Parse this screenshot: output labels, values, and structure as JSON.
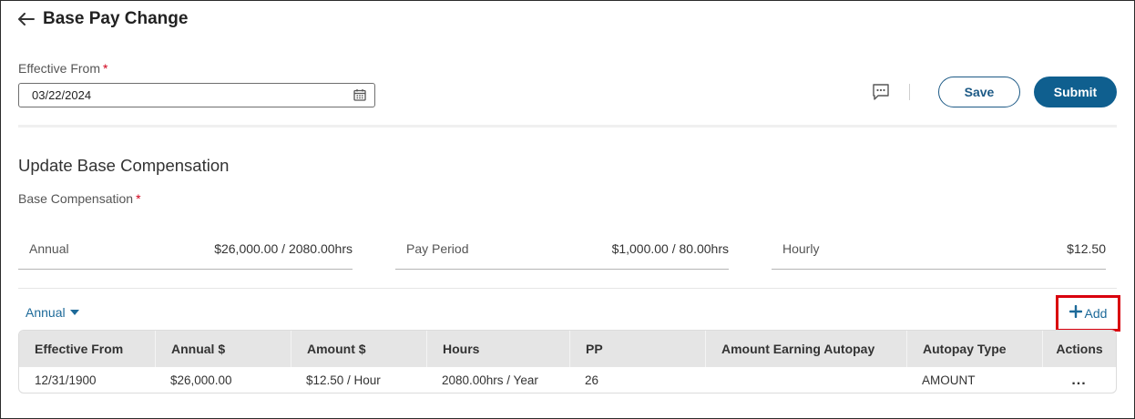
{
  "header": {
    "title": "Base Pay Change",
    "back_icon": "arrow-left-icon"
  },
  "effective_from": {
    "label": "Effective From",
    "required_mark": "*",
    "value": "03/22/2024",
    "icon": "calendar-icon"
  },
  "actions": {
    "comment_icon": "comment-icon",
    "save_label": "Save",
    "submit_label": "Submit"
  },
  "section": {
    "title": "Update Base Compensation",
    "base_comp_label": "Base Compensation",
    "required_mark": "*"
  },
  "compensation": [
    {
      "label": "Annual",
      "value": "$26,000.00 / 2080.00hrs"
    },
    {
      "label": "Pay Period",
      "value": "$1,000.00 / 80.00hrs"
    },
    {
      "label": "Hourly",
      "value": "$12.50"
    }
  ],
  "period_selector": {
    "value": "Annual",
    "icon": "caret-down-icon"
  },
  "add_button": {
    "label": "Add",
    "icon": "plus-icon"
  },
  "table": {
    "columns": [
      "Effective From",
      "Annual $",
      "Amount $",
      "Hours",
      "PP",
      "Amount Earning Autopay",
      "Autopay Type",
      "Actions"
    ],
    "rows": [
      [
        "12/31/1900",
        "$26,000.00",
        "$12.50 / Hour",
        "2080.00hrs / Year",
        "26",
        "",
        "AMOUNT",
        "..."
      ]
    ],
    "row_action_icon": "ellipsis-icon"
  },
  "colors": {
    "brand": "#0f5f8f",
    "link": "#1d6a99",
    "required": "#d0021b",
    "highlight": "#d9000d"
  }
}
